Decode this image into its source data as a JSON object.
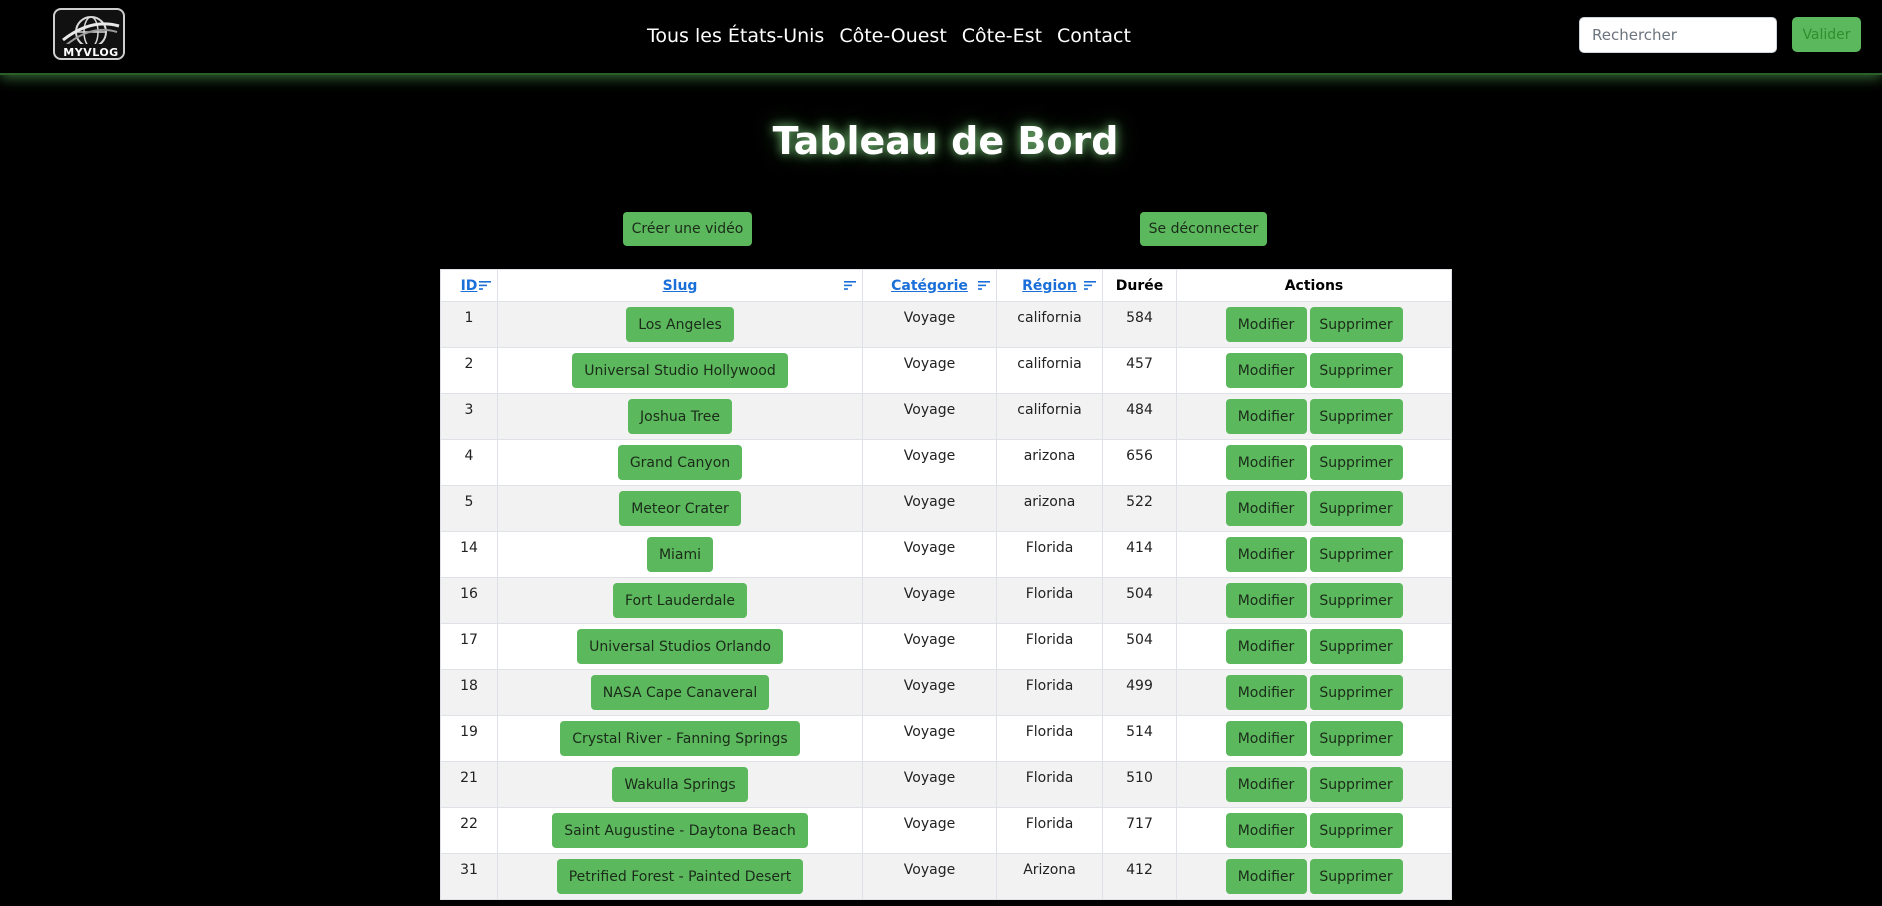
{
  "header": {
    "logo_text": "MYVLOG",
    "nav": [
      "Tous les États-Unis",
      "Côte-Ouest",
      "Côte-Est",
      "Contact"
    ],
    "search_placeholder": "Rechercher",
    "search_button": "Valider"
  },
  "page": {
    "title": "Tableau de Bord",
    "create_button": "Créer une vidéo",
    "logout_button": "Se déconnecter"
  },
  "table": {
    "headers": {
      "id": "ID",
      "slug": "Slug",
      "category": "Catégorie",
      "region": "Région",
      "duration": "Durée",
      "actions": "Actions"
    },
    "action_labels": {
      "modify": "Modifier",
      "delete": "Supprimer"
    },
    "rows": [
      {
        "id": "1",
        "slug": "Los Angeles",
        "category": "Voyage",
        "region": "california",
        "duration": "584"
      },
      {
        "id": "2",
        "slug": "Universal Studio Hollywood",
        "category": "Voyage",
        "region": "california",
        "duration": "457"
      },
      {
        "id": "3",
        "slug": "Joshua Tree",
        "category": "Voyage",
        "region": "california",
        "duration": "484"
      },
      {
        "id": "4",
        "slug": "Grand Canyon",
        "category": "Voyage",
        "region": "arizona",
        "duration": "656"
      },
      {
        "id": "5",
        "slug": "Meteor Crater",
        "category": "Voyage",
        "region": "arizona",
        "duration": "522"
      },
      {
        "id": "14",
        "slug": "Miami",
        "category": "Voyage",
        "region": "Florida",
        "duration": "414"
      },
      {
        "id": "16",
        "slug": "Fort Lauderdale",
        "category": "Voyage",
        "region": "Florida",
        "duration": "504"
      },
      {
        "id": "17",
        "slug": "Universal Studios Orlando",
        "category": "Voyage",
        "region": "Florida",
        "duration": "504"
      },
      {
        "id": "18",
        "slug": "NASA Cape Canaveral",
        "category": "Voyage",
        "region": "Florida",
        "duration": "499"
      },
      {
        "id": "19",
        "slug": "Crystal River - Fanning Springs",
        "category": "Voyage",
        "region": "Florida",
        "duration": "514"
      },
      {
        "id": "21",
        "slug": "Wakulla Springs",
        "category": "Voyage",
        "region": "Florida",
        "duration": "510"
      },
      {
        "id": "22",
        "slug": "Saint Augustine - Daytona Beach",
        "category": "Voyage",
        "region": "Florida",
        "duration": "717"
      },
      {
        "id": "31",
        "slug": "Petrified Forest - Painted Desert",
        "category": "Voyage",
        "region": "Arizona",
        "duration": "412"
      }
    ]
  },
  "colors": {
    "accent_green": "#5cb85c",
    "link_blue": "#1a6fd8",
    "background": "#000000"
  }
}
